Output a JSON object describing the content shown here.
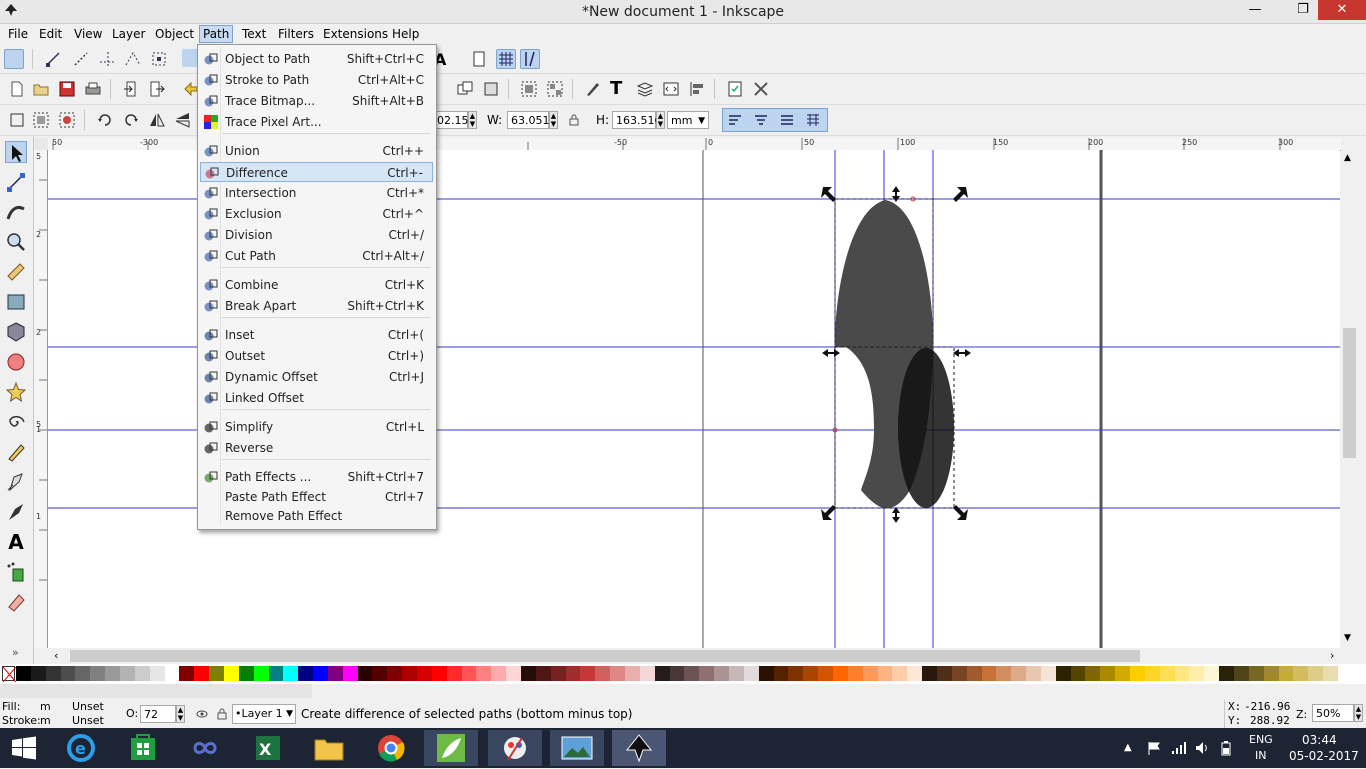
{
  "window": {
    "title": "*New document 1 - Inkscape"
  },
  "menubar": [
    {
      "label": "File"
    },
    {
      "label": "Edit"
    },
    {
      "label": "View"
    },
    {
      "label": "Layer"
    },
    {
      "label": "Object"
    },
    {
      "label": "Path"
    },
    {
      "label": "Text"
    },
    {
      "label": "Filters"
    },
    {
      "label": "Extensions"
    },
    {
      "label": "Help"
    }
  ],
  "path_menu": {
    "items": [
      {
        "label": "Object to Path",
        "shortcut": "Shift+Ctrl+C",
        "icon": "object-to-path-icon"
      },
      {
        "label": "Stroke to Path",
        "shortcut": "Ctrl+Alt+C",
        "icon": "stroke-to-path-icon"
      },
      {
        "label": "Trace Bitmap...",
        "shortcut": "Shift+Alt+B",
        "icon": "trace-bitmap-icon"
      },
      {
        "label": "Trace Pixel Art...",
        "shortcut": "",
        "icon": "trace-pixel-art-icon"
      },
      {
        "label": "Union",
        "shortcut": "Ctrl++",
        "icon": "union-icon"
      },
      {
        "label": "Difference",
        "shortcut": "Ctrl+-",
        "icon": "difference-icon",
        "highlighted": true
      },
      {
        "label": "Intersection",
        "shortcut": "Ctrl+*",
        "icon": "intersection-icon"
      },
      {
        "label": "Exclusion",
        "shortcut": "Ctrl+^",
        "icon": "exclusion-icon"
      },
      {
        "label": "Division",
        "shortcut": "Ctrl+/",
        "icon": "division-icon"
      },
      {
        "label": "Cut Path",
        "shortcut": "Ctrl+Alt+/",
        "icon": "cut-path-icon"
      },
      {
        "label": "Combine",
        "shortcut": "Ctrl+K",
        "icon": "combine-icon"
      },
      {
        "label": "Break Apart",
        "shortcut": "Shift+Ctrl+K",
        "icon": "break-apart-icon"
      },
      {
        "label": "Inset",
        "shortcut": "Ctrl+(",
        "icon": "inset-icon"
      },
      {
        "label": "Outset",
        "shortcut": "Ctrl+)",
        "icon": "outset-icon"
      },
      {
        "label": "Dynamic Offset",
        "shortcut": "Ctrl+J",
        "icon": "dynamic-offset-icon"
      },
      {
        "label": "Linked Offset",
        "shortcut": "",
        "icon": "linked-offset-icon"
      },
      {
        "label": "Simplify",
        "shortcut": "Ctrl+L",
        "icon": "simplify-icon"
      },
      {
        "label": "Reverse",
        "shortcut": "",
        "icon": "reverse-icon"
      },
      {
        "label": "Path Effects ...",
        "shortcut": "Shift+Ctrl+7",
        "icon": "path-effects-icon"
      },
      {
        "label": "Paste Path Effect",
        "shortcut": "Ctrl+7",
        "icon": ""
      },
      {
        "label": "Remove Path Effect",
        "shortcut": "",
        "icon": ""
      }
    ]
  },
  "toolbar3": {
    "x_value": "02.150",
    "w_label": "W:",
    "w_value": "63.051",
    "h_label": "H:",
    "h_value": "163.516",
    "unit": "mm"
  },
  "rulers": {
    "h_ticks": [
      "50",
      "-300",
      "-50",
      "0",
      "50",
      "100",
      "150",
      "200",
      "250",
      "300"
    ],
    "v_ticks": [
      "5",
      "2",
      "2",
      "5",
      "1",
      "1"
    ]
  },
  "status": {
    "fill_label": "Fill:",
    "fill_value": "m",
    "fill_state": "Unset",
    "stroke_label": "Stroke:",
    "stroke_value": "m",
    "stroke_state": "Unset",
    "opacity_label": "O:",
    "opacity_value": "72",
    "layer": "•Layer 1",
    "message": "Create difference of selected paths (bottom minus top)",
    "x_label": "X:",
    "x_value": "-216.96",
    "y_label": "Y:",
    "y_value": "288.92",
    "zoom_label": "Z:",
    "zoom_value": "50%"
  },
  "taskbar": {
    "lang": "ENG",
    "region": "IN",
    "time": "03:44",
    "date": "05-02-2017"
  },
  "colors": {
    "shape_dark": "#4a4a4a",
    "shape_darker": "#111111",
    "guide": "#3a3acc",
    "menu_highlight": "#d6e6f7"
  }
}
